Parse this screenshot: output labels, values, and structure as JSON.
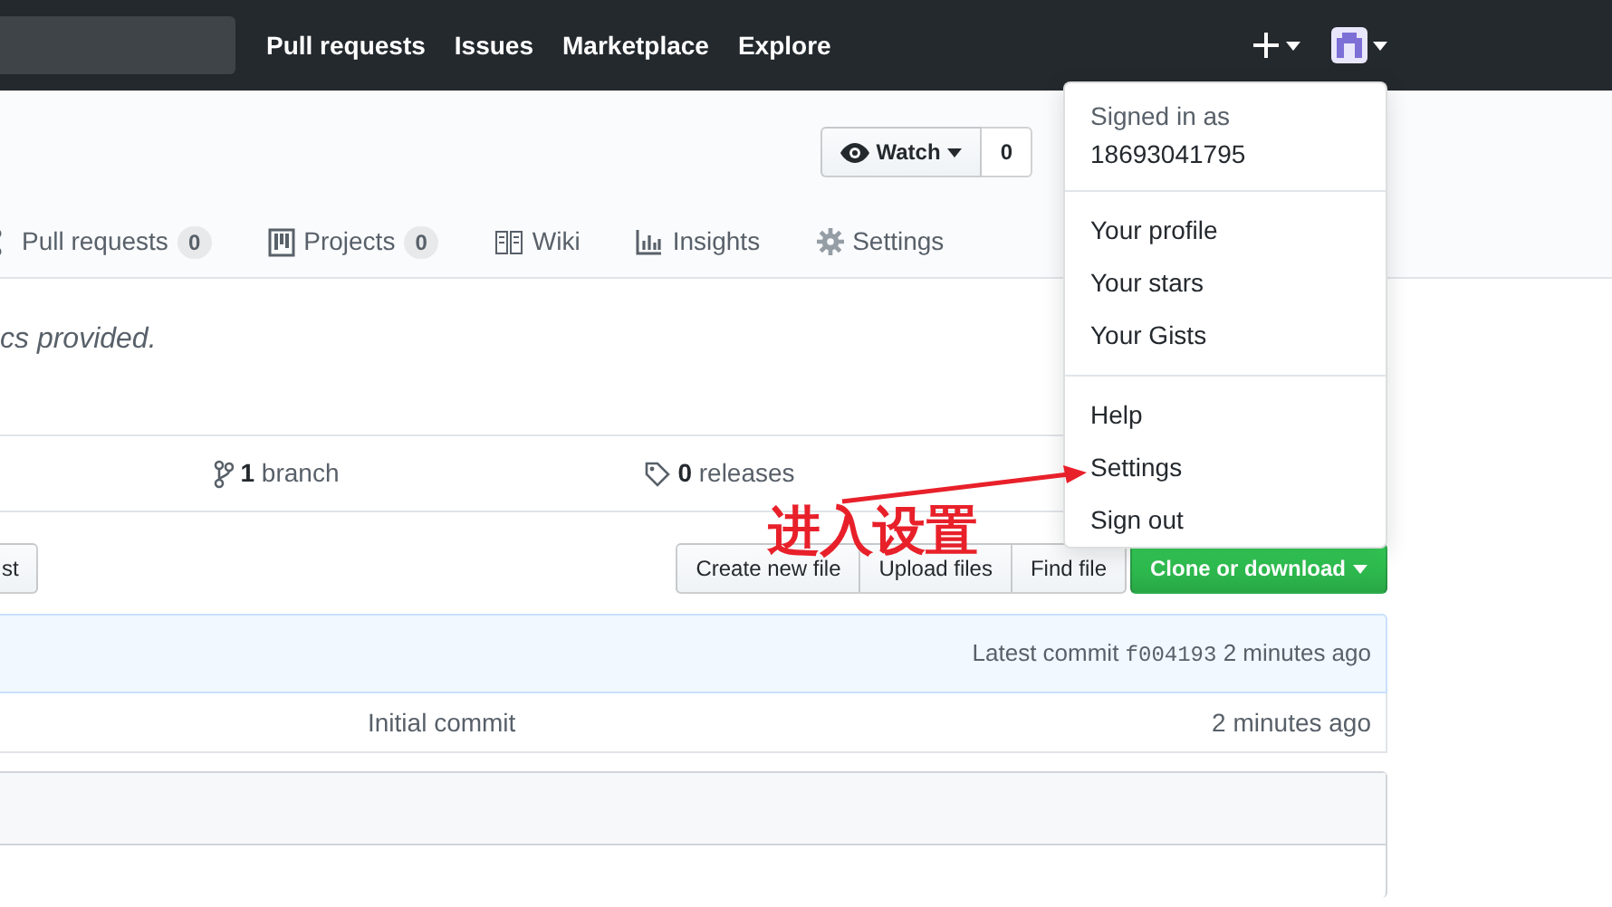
{
  "header": {
    "nav": [
      "Pull requests",
      "Issues",
      "Marketplace",
      "Explore"
    ]
  },
  "repo_actions": {
    "watch": {
      "label": "Watch",
      "count": "0"
    }
  },
  "tabs": [
    {
      "label": "Pull requests",
      "count": "0",
      "kind": "pr",
      "selected": false
    },
    {
      "label": "Projects",
      "count": "0",
      "kind": "project",
      "selected": false
    },
    {
      "label": "Wiki",
      "kind": "wiki",
      "selected": false
    },
    {
      "label": "Insights",
      "kind": "graph",
      "selected": false
    },
    {
      "label": "Settings",
      "kind": "gear",
      "selected": false
    }
  ],
  "description": "cs provided.",
  "summary": [
    {
      "count": "1",
      "label": "branch",
      "kind": "branch"
    },
    {
      "count": "0",
      "label": "releases",
      "kind": "tag"
    }
  ],
  "file_nav": {
    "left_button": "st",
    "buttons": [
      "Create new file",
      "Upload files",
      "Find file"
    ],
    "clone_button": "Clone or download"
  },
  "commit_bar": {
    "label": "Latest commit",
    "sha": "f004193",
    "time": "2 minutes ago"
  },
  "files": [
    {
      "message": "Initial commit",
      "time": "2 minutes ago"
    }
  ],
  "user_menu": {
    "header": "Signed in as",
    "username": "18693041795",
    "groups": [
      [
        {
          "label": "Your profile"
        },
        {
          "label": "Your stars"
        },
        {
          "label": "Your Gists"
        }
      ],
      [
        {
          "label": "Help"
        },
        {
          "label": "Settings"
        },
        {
          "label": "Sign out"
        }
      ]
    ]
  },
  "annotation": {
    "text": "进入设置"
  }
}
